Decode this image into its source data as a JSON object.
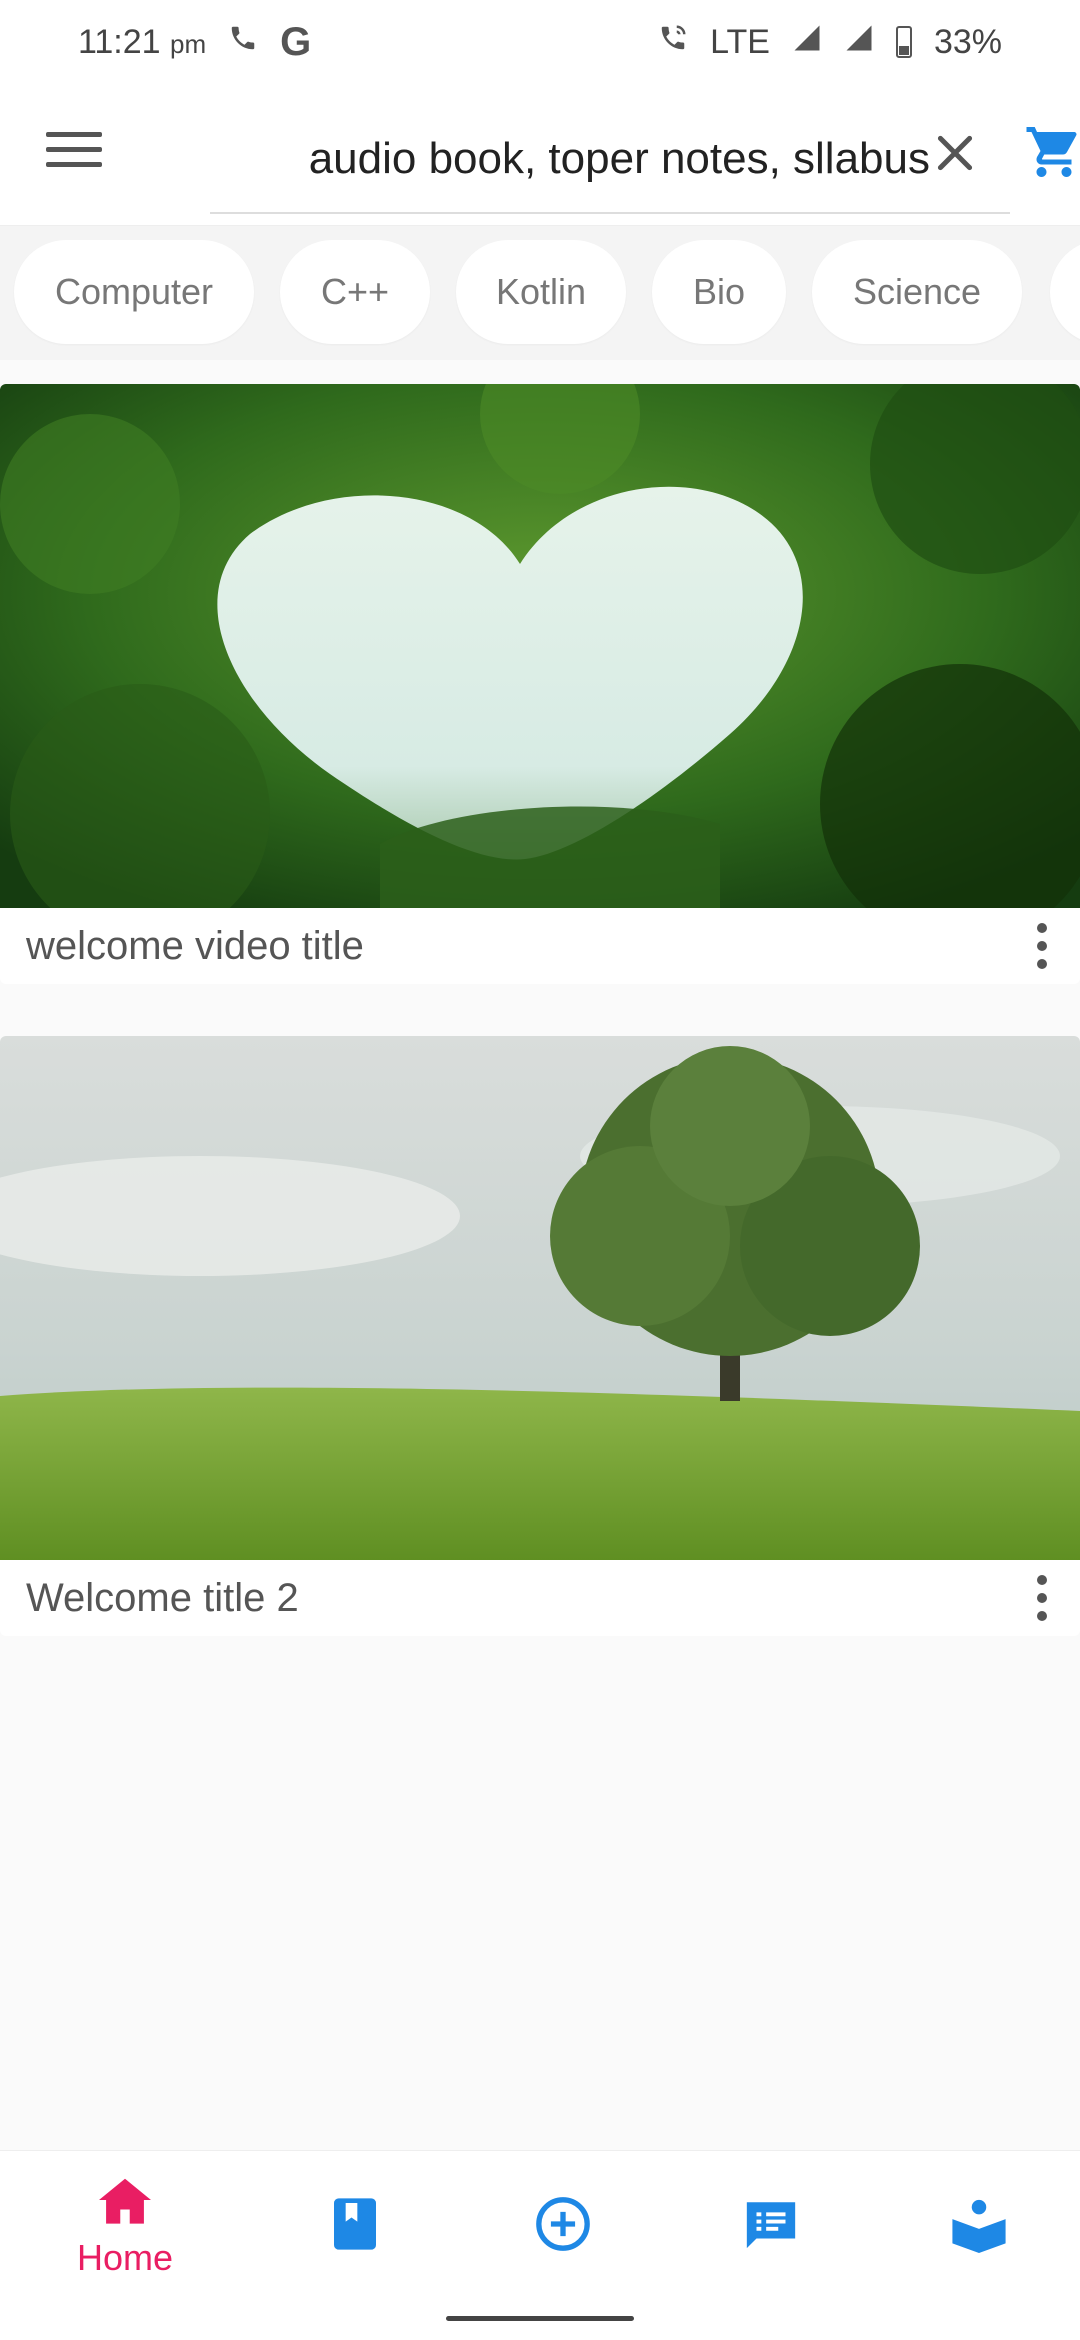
{
  "status_bar": {
    "time": "11:21",
    "time_suffix": "pm",
    "network": "LTE",
    "battery": "33%",
    "icons": [
      "phone-icon",
      "google-icon",
      "wifi-calling-icon",
      "signal-icon",
      "battery-icon"
    ]
  },
  "toolbar": {
    "menu_icon": "menu-icon",
    "search_value": "audio book, toper notes, sllabus",
    "clear_icon": "close-icon",
    "cart_icon": "cart-icon"
  },
  "chips": [
    "Computer",
    "C++",
    "Kotlin",
    "Bio",
    "Science"
  ],
  "cards": [
    {
      "title": "welcome video title",
      "image": "heart-shaped-foliage-opening",
      "more_icon": "more-vertical-icon"
    },
    {
      "title": "Welcome title 2",
      "image": "lone-tree-on-grassy-field",
      "more_icon": "more-vertical-icon"
    }
  ],
  "bottom_nav": {
    "items": [
      {
        "label": "Home",
        "icon": "home-icon",
        "active": true
      },
      {
        "label": "",
        "icon": "book-icon"
      },
      {
        "label": "",
        "icon": "add-circle-icon"
      },
      {
        "label": "",
        "icon": "chat-list-icon"
      },
      {
        "label": "",
        "icon": "reader-icon"
      }
    ]
  },
  "colors": {
    "accent_pink": "#e91e63",
    "accent_blue": "#1e88e5",
    "chip_text": "#777777"
  }
}
